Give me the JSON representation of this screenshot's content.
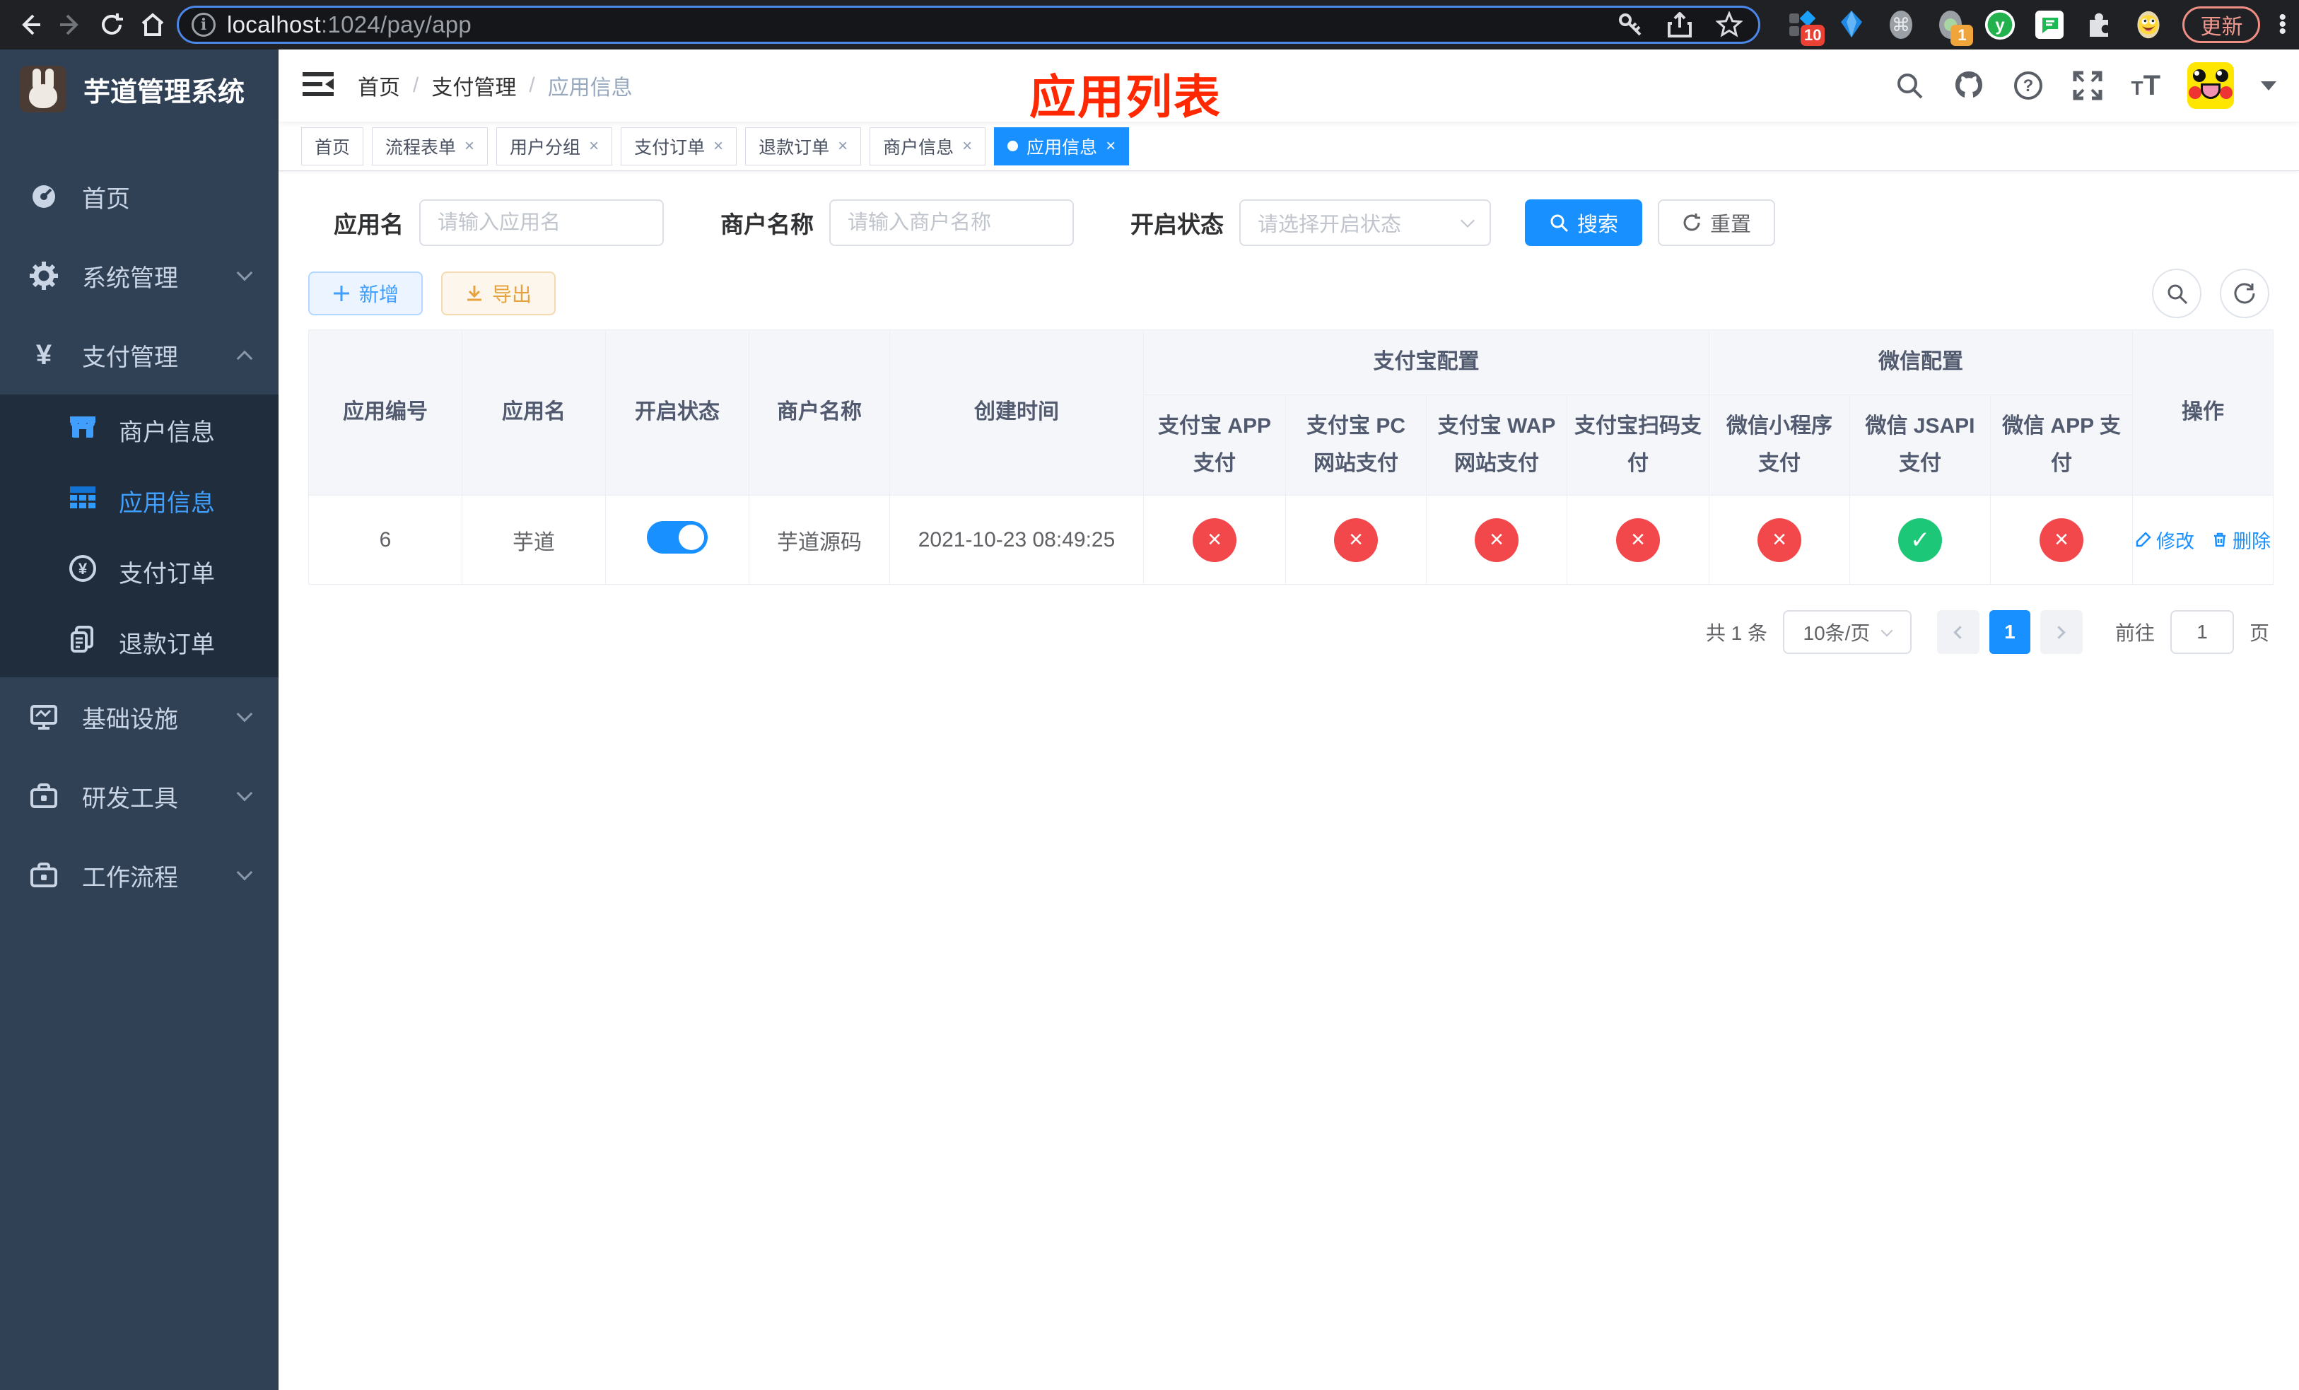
{
  "browser": {
    "url": {
      "host": "localhost",
      "path": ":1024/pay/app"
    },
    "update_label": "更新",
    "extension_badges": {
      "grid_badge": "10",
      "profile_badge": "1"
    },
    "ext_letter": "y"
  },
  "sidebar": {
    "logo_title": "芋道管理系统",
    "items": [
      {
        "label": "首页"
      },
      {
        "label": "系统管理"
      },
      {
        "label": "支付管理"
      },
      {
        "label": "基础设施"
      },
      {
        "label": "研发工具"
      },
      {
        "label": "工作流程"
      }
    ],
    "payment_submenu": [
      {
        "label": "商户信息"
      },
      {
        "label": "应用信息"
      },
      {
        "label": "支付订单"
      },
      {
        "label": "退款订单"
      }
    ]
  },
  "header": {
    "breadcrumb": [
      "首页",
      "支付管理",
      "应用信息"
    ],
    "annotation_title": "应用列表",
    "font_icon_big": "T",
    "font_icon_small": "T"
  },
  "tabs": [
    {
      "label": "首页"
    },
    {
      "label": "流程表单"
    },
    {
      "label": "用户分组"
    },
    {
      "label": "支付订单"
    },
    {
      "label": "退款订单"
    },
    {
      "label": "商户信息"
    },
    {
      "label": "应用信息"
    }
  ],
  "filters": {
    "app_name_label": "应用名",
    "app_name_placeholder": "请输入应用名",
    "merchant_label": "商户名称",
    "merchant_placeholder": "请输入商户名称",
    "status_label": "开启状态",
    "status_placeholder": "请选择开启状态",
    "search_label": "搜索",
    "reset_label": "重置"
  },
  "toolbar": {
    "add_label": "新增",
    "export_label": "导出"
  },
  "table": {
    "plain_columns": [
      "应用编号",
      "应用名",
      "开启状态",
      "商户名称",
      "创建时间"
    ],
    "alipay_group": "支付宝配置",
    "wechat_group": "微信配置",
    "alipay_columns": [
      "支付宝 APP 支付",
      "支付宝 PC 网站支付",
      "支付宝 WAP 网站支付",
      "支付宝扫码支付"
    ],
    "wechat_columns": [
      "微信小程序支付",
      "微信 JSAPI 支付",
      "微信 APP 支付"
    ],
    "actions_column": "操作",
    "row": {
      "id": "6",
      "name": "芋道",
      "enabled": true,
      "merchant": "芋道源码",
      "created_at": "2021-10-23 08:49:25",
      "statuses": [
        "no",
        "no",
        "no",
        "no",
        "no",
        "yes",
        "no"
      ],
      "edit_label": "修改",
      "delete_label": "删除"
    }
  },
  "pagination": {
    "total_text": "共 1 条",
    "page_size": "10条/页",
    "current_page": "1",
    "goto_label": "前往",
    "goto_value": "1",
    "page_unit": "页"
  },
  "colors": {
    "primary": "#1890ff",
    "menu_active": "#409eff",
    "sidebar_bg": "#304156",
    "submenu_bg": "#1f2d3d",
    "success": "#1cc777",
    "danger": "#f3484b",
    "warning": "#e6a23c",
    "annotation": "#ff2800"
  }
}
